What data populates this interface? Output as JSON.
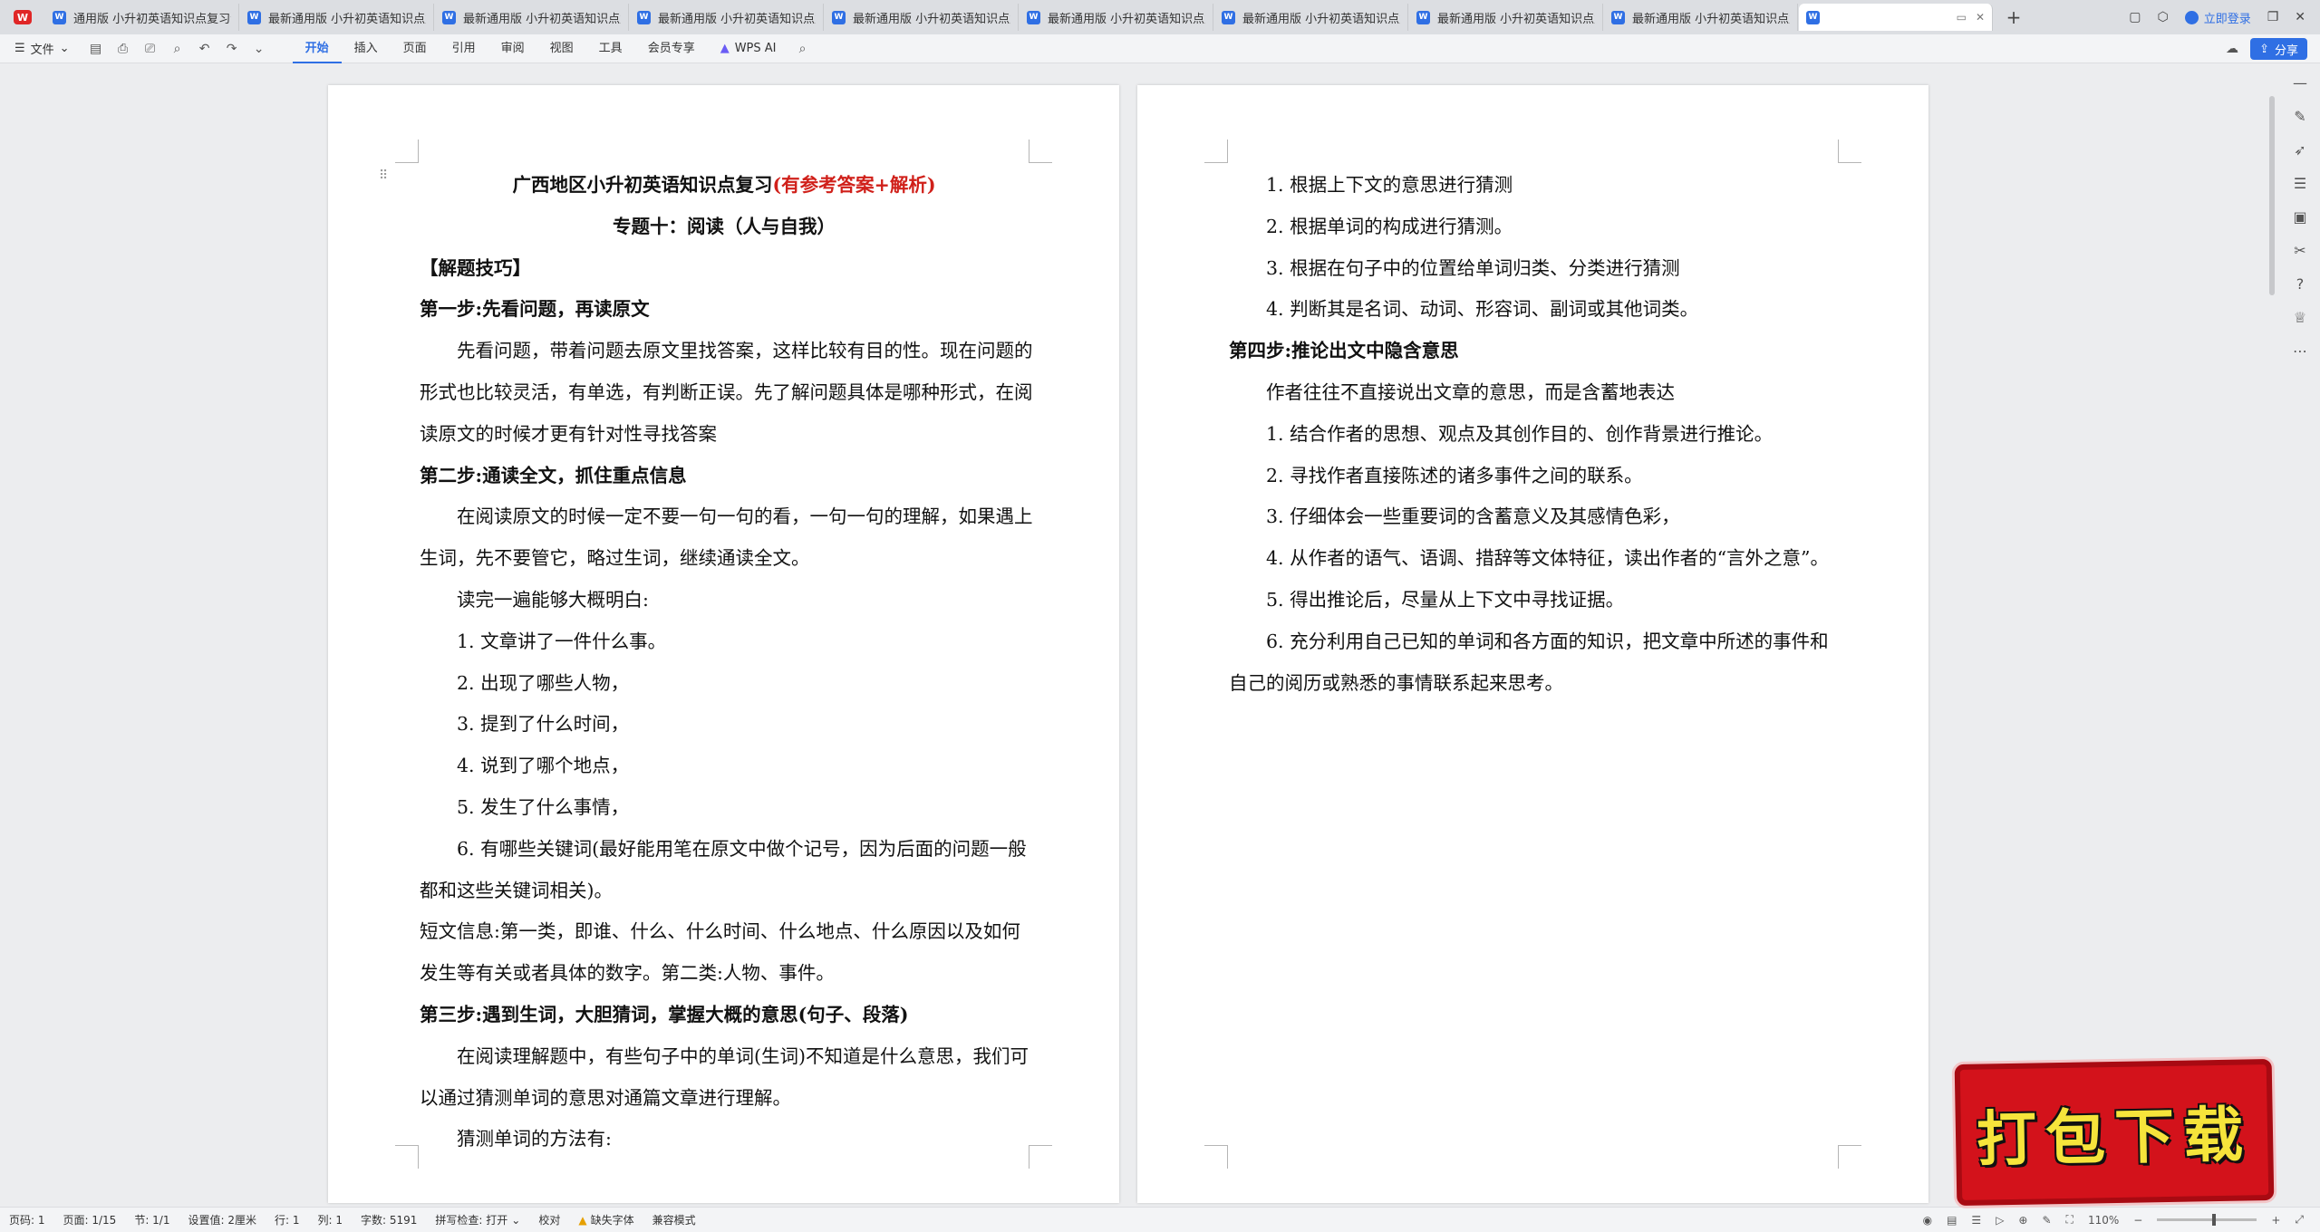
{
  "tabbar": {
    "logo": "W",
    "tabs": [
      {
        "label": "通用版 小升初英语知识点复习专题"
      },
      {
        "label": "最新通用版 小升初英语知识点复习"
      },
      {
        "label": "最新通用版 小升初英语知识点复习"
      },
      {
        "label": "最新通用版 小升初英语知识点复习"
      },
      {
        "label": "最新通用版 小升初英语知识点复习"
      },
      {
        "label": "最新通用版 小升初英语知识点复习"
      },
      {
        "label": "最新通用版 小升初英语知识点复习"
      },
      {
        "label": "最新通用版 小升初英语知识点复习"
      },
      {
        "label": "最新通用版 小升初英语知识点复习"
      }
    ],
    "active_tab": {
      "label": ""
    },
    "login_label": "立即登录"
  },
  "ribbon": {
    "file_label": "文件",
    "menu": [
      "开始",
      "插入",
      "页面",
      "引用",
      "审阅",
      "视图",
      "工具",
      "会员专享"
    ],
    "wps_ai": "WPS AI",
    "share_label": "分享"
  },
  "page1": {
    "title_black": "广西地区小升初英语知识点复习",
    "title_red": "(有参考答案+解析)",
    "lines": [
      "专题十：阅读（人与自我）",
      "【解题技巧】",
      "第一步:先看问题，再读原文",
      "先看问题，带着问题去原文里找答案，这样比较有目的性。现在问题的",
      "形式也比较灵活，有单选，有判断正误。先了解问题具体是哪种形式，在阅",
      "读原文的时候才更有针对性寻找答案",
      "第二步:通读全文，抓住重点信息",
      "在阅读原文的时候一定不要一句一句的看，一句一句的理解，如果遇上",
      "生词，先不要管它，略过生词，继续通读全文。",
      "读完一遍能够大概明白:",
      "1.  文章讲了一件什么事。",
      "2.  出现了哪些人物，",
      "3.  提到了什么时间，",
      "4.  说到了哪个地点，",
      "5.  发生了什么事情，",
      "6.  有哪些关键词(最好能用笔在原文中做个记号，因为后面的问题一般",
      "都和这些关键词相关)。",
      "短文信息:第一类，即谁、什么、什么时间、什么地点、什么原因以及如何",
      "发生等有关或者具体的数字。第二类:人物、事件。",
      "第三步:遇到生词，大胆猜词，掌握大概的意思(句子、段落)",
      "在阅读理解题中，有些句子中的单词(生词)不知道是什么意思，我们可",
      "以通过猜测单词的意思对通篇文章进行理解。",
      "猜测单词的方法有:"
    ]
  },
  "page2": {
    "lines": [
      "1.  根据上下文的意思进行猜测",
      "2.  根据单词的构成进行猜测。",
      "3.  根据在句子中的位置给单词归类、分类进行猜测",
      "4.  判断其是名词、动词、形容词、副词或其他词类。",
      "第四步:推论出文中隐含意思",
      "作者往往不直接说出文章的意思，而是含蓄地表达",
      "1.  结合作者的思想、观点及其创作目的、创作背景进行推论。",
      "2.  寻找作者直接陈述的诸多事件之间的联系。",
      "3.  仔细体会一些重要词的含蓄意义及其感情色彩，",
      "4.  从作者的语气、语调、措辞等文体特征，读出作者的“言外之意”。",
      "5.  得出推论后，尽量从上下文中寻找证据。",
      "6.  充分利用自己已知的单词和各方面的知识，把文章中所述的事件和",
      "自己的阅历或熟悉的事情联系起来思考。"
    ]
  },
  "statusbar": {
    "page_num": "页码: 1",
    "page_count": "页面: 1/15",
    "section": "节: 1/1",
    "setting": "设置值: 2厘米",
    "row": "行: 1",
    "col": "列: 1",
    "word_count": "字数: 5191",
    "spell": "拼写检查: 打开",
    "proof": "校对",
    "missing_font": "缺失字体",
    "compat": "兼容模式",
    "zoom": "110%",
    "zoom_level": 0.55
  },
  "badge": {
    "text": "打包下载"
  },
  "colors": {
    "accent": "#2f6fe4",
    "title_red": "#d0201a",
    "badge_red": "#d3121b",
    "badge_text": "#f6e43b"
  }
}
